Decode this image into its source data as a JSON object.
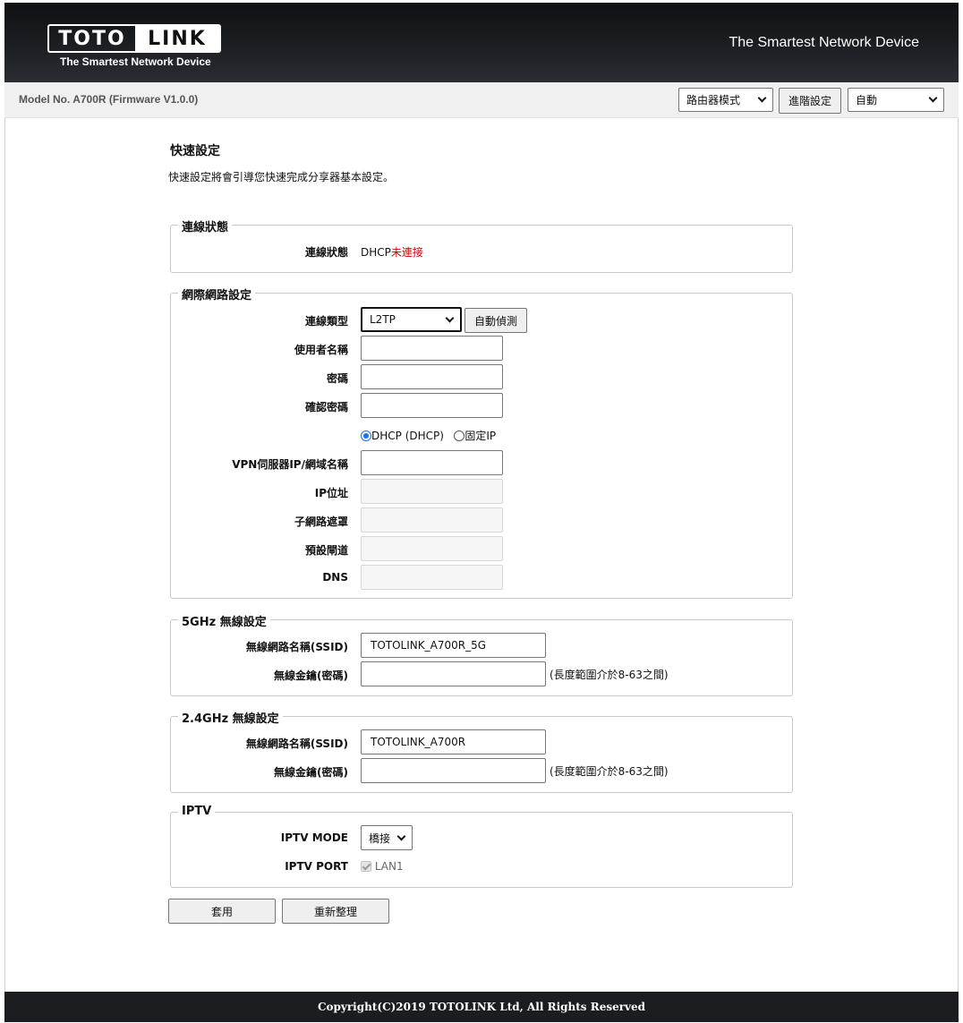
{
  "header": {
    "logo_left": "TOTO",
    "logo_right": "LINK",
    "logo_tagline": "The Smartest Network Device",
    "tagline": "The Smartest Network Device"
  },
  "topbar": {
    "model": "Model No. A700R (Firmware V1.0.0)",
    "mode_select": "路由器模式",
    "advanced_button": "進階設定",
    "language_select": "自動"
  },
  "page": {
    "title": "快速設定",
    "description": "快速設定將會引導您快速完成分享器基本設定。"
  },
  "connection_status": {
    "legend": "連線狀態",
    "label": "連線狀態",
    "value_prefix": "DHCP",
    "value_status": "未連接"
  },
  "internet": {
    "legend": "網際網路設定",
    "type_label": "連線類型",
    "type_value": "L2TP",
    "auto_detect_button": "自動偵測",
    "username_label": "使用者名稱",
    "password_label": "密碼",
    "confirm_password_label": "確認密碼",
    "radio_dhcp": "DHCP (DHCP)",
    "radio_static": "固定IP",
    "vpn_server_label": "VPN伺服器IP/網域名稱",
    "ip_label": "IP位址",
    "subnet_label": "子網路遮罩",
    "gateway_label": "預設閘道",
    "dns_label": "DNS"
  },
  "wifi5g": {
    "legend": "5GHz 無線設定",
    "ssid_label": "無線網路名稱(SSID)",
    "ssid_value": "TOTOLINK_A700R_5G",
    "key_label": "無線金鑰(密碼)",
    "key_hint": "(長度範圍介於8-63之間)"
  },
  "wifi24g": {
    "legend": "2.4GHz 無線設定",
    "ssid_label": "無線網路名稱(SSID)",
    "ssid_value": "TOTOLINK_A700R",
    "key_label": "無線金鑰(密碼)",
    "key_hint": "(長度範圍介於8-63之間)"
  },
  "iptv": {
    "legend": "IPTV",
    "mode_label": "IPTV MODE",
    "mode_value": "橋接",
    "port_label": "IPTV PORT",
    "port_value": "LAN1"
  },
  "actions": {
    "apply": "套用",
    "reset": "重新整理"
  },
  "footer": {
    "copyright": "Copyright(C)2019 TOTOLINK Ltd, All Rights Reserved"
  },
  "colors": {
    "header_bg": "#1d2024",
    "status_red": "#d40000",
    "radio_blue": "#1a73e8"
  }
}
